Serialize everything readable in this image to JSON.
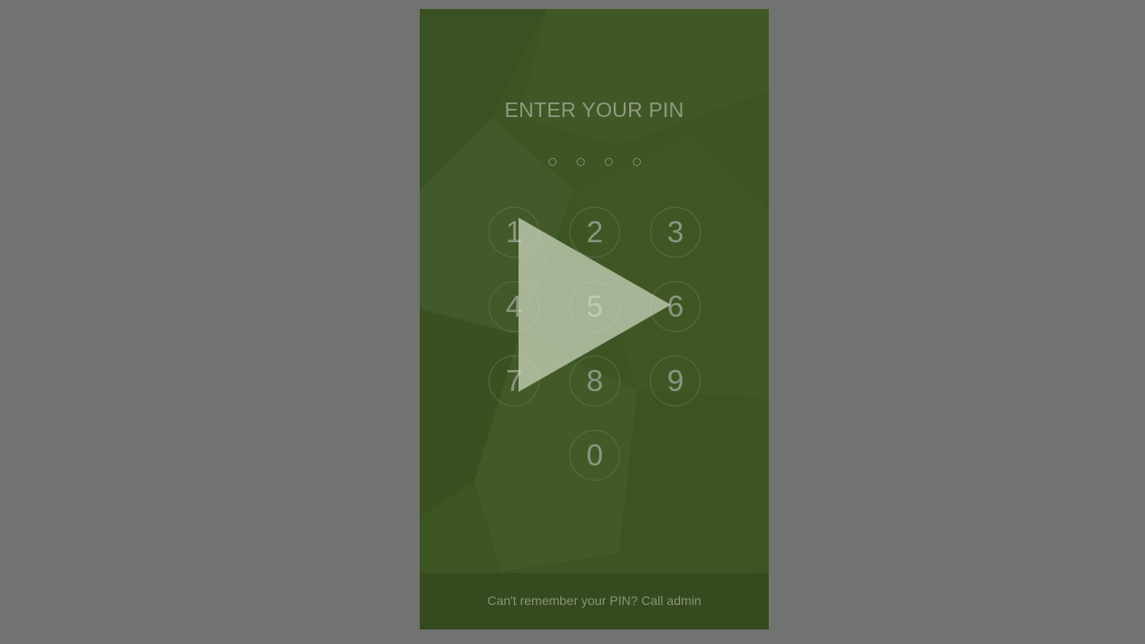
{
  "pin_screen": {
    "title": "ENTER YOUR PIN",
    "dot_count": 4,
    "keys": [
      "1",
      "2",
      "3",
      "4",
      "5",
      "6",
      "7",
      "8",
      "9",
      "0"
    ],
    "footer_text": "Can't remember your PIN? Call admin"
  },
  "video_overlay": {
    "icon": "play-icon"
  },
  "colors": {
    "page_background": "#717370",
    "panel_background": "#3d5423",
    "footer_background": "#354a1e"
  }
}
